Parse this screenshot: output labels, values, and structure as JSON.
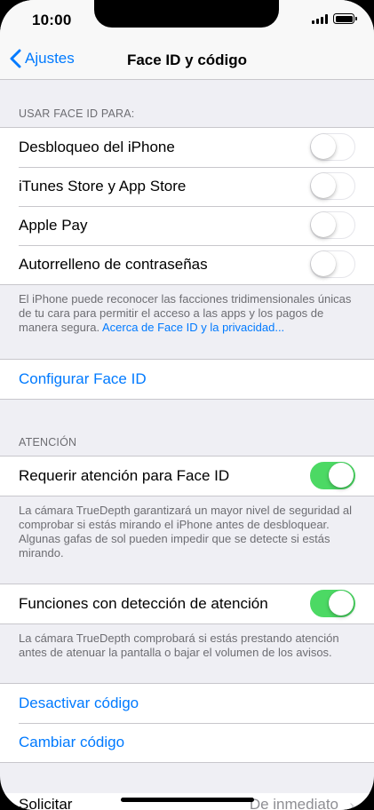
{
  "status_bar": {
    "time": "10:00"
  },
  "nav": {
    "back_label": "Ajustes",
    "title": "Face ID y código"
  },
  "face_id_section": {
    "header": "USAR FACE ID PARA:",
    "items": [
      {
        "label": "Desbloqueo del iPhone",
        "toggle": false
      },
      {
        "label": "iTunes Store y App Store",
        "toggle": false
      },
      {
        "label": "Apple Pay",
        "toggle": false
      },
      {
        "label": "Autorrelleno de contraseñas",
        "toggle": false
      }
    ],
    "footer": "El iPhone puede reconocer las facciones tridimensionales únicas de tu cara para permitir el acceso a las apps y los pagos de manera segura.",
    "footer_link": "Acerca de Face ID y la privacidad..."
  },
  "configure": {
    "label": "Configurar Face ID"
  },
  "attention_section": {
    "header": "ATENCIÓN",
    "require_label": "Requerir atención para Face ID",
    "require_toggle": true,
    "require_footer": "La cámara TrueDepth garantizará un mayor nivel de seguridad al comprobar si estás mirando el iPhone antes de desbloquear. Algunas gafas de sol pueden impedir que se detecte si estás mirando.",
    "aware_label": "Funciones con detección de atención",
    "aware_toggle": true,
    "aware_footer": "La cámara TrueDepth comprobará si estás prestando atención antes de atenuar la pantalla o bajar el volumen de los avisos."
  },
  "passcode": {
    "disable_label": "Desactivar código",
    "change_label": "Cambiar código"
  },
  "peek": {
    "label": "Solicitar",
    "value": "De inmediato"
  },
  "colors": {
    "accent": "#007aff",
    "toggle_on": "#4cd964",
    "background": "#efeff4"
  }
}
